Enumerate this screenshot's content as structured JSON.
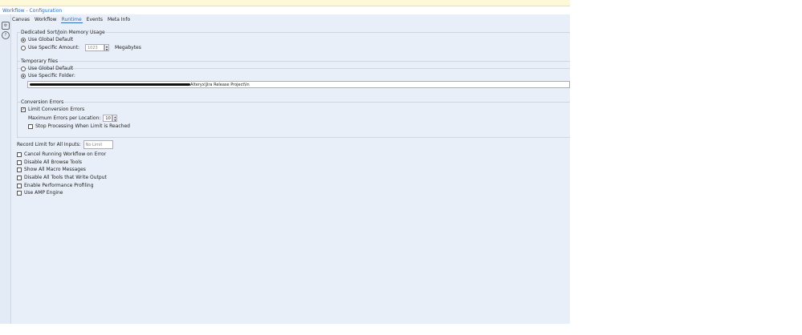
{
  "header": {
    "title": "Workflow - Configuration"
  },
  "tabs": [
    "Canvas",
    "Workflow",
    "Runtime",
    "Events",
    "Meta Info"
  ],
  "memory": {
    "label": "Dedicated Sort/Join Memory Usage",
    "opt_global": "Use Global Default",
    "opt_specific": "Use Specific Amount:",
    "amount": "1023",
    "unit": "Megabytes"
  },
  "temp": {
    "label": "Temporary files",
    "opt_global": "Use Global Default",
    "opt_specific": "Use Specific Folder:",
    "folder_suffix": "Alteryx\\Jira Release Project\\In"
  },
  "conversion": {
    "label": "Conversion Errors",
    "limit": "Limit Conversion Errors",
    "max_label": "Maximum Errors per Location:",
    "max_value": "10",
    "stop": "Stop Processing When Limit is Reached"
  },
  "record_limit": {
    "label": "Record Limit for All Inputs:",
    "placeholder": "No Limit"
  },
  "options": [
    "Cancel Running Workflow on Error",
    "Disable All Browse Tools",
    "Show All Macro Messages",
    "Disable All Tools that Write Output",
    "Enable Performance Profiling",
    "Use AMP Engine"
  ]
}
